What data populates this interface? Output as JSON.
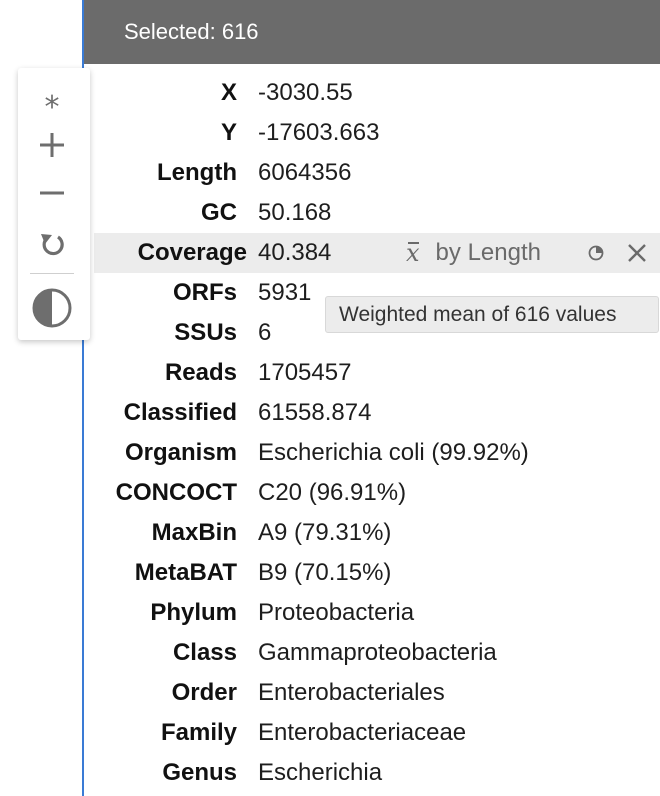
{
  "header": {
    "title": "Selected: 616"
  },
  "toolbar": {
    "asterisk": "*",
    "buttons": [
      "asterisk-icon",
      "plus-icon",
      "minus-icon",
      "reset-icon",
      "contrast-icon"
    ]
  },
  "coverage_tools": {
    "mean_symbol": "x",
    "weight_label": "by Length",
    "tooltip": "Weighted mean of 616 values"
  },
  "rows": [
    {
      "key": "X",
      "value": "-3030.55"
    },
    {
      "key": "Y",
      "value": "-17603.663"
    },
    {
      "key": "Length",
      "value": "6064356"
    },
    {
      "key": "GC",
      "value": "50.168"
    },
    {
      "key": "Coverage",
      "value": "40.384"
    },
    {
      "key": "ORFs",
      "value": "5931"
    },
    {
      "key": "SSUs",
      "value": "6"
    },
    {
      "key": "Reads",
      "value": "1705457"
    },
    {
      "key": "Classified",
      "value": "61558.874"
    },
    {
      "key": "Organism",
      "value": "Escherichia coli (99.92%)"
    },
    {
      "key": "CONCOCT",
      "value": "C20 (96.91%)"
    },
    {
      "key": "MaxBin",
      "value": "A9 (79.31%)"
    },
    {
      "key": "MetaBAT",
      "value": "B9 (70.15%)"
    },
    {
      "key": "Phylum",
      "value": "Proteobacteria"
    },
    {
      "key": "Class",
      "value": "Gammaproteobacteria"
    },
    {
      "key": "Order",
      "value": "Enterobacteriales"
    },
    {
      "key": "Family",
      "value": "Enterobacteriaceae"
    },
    {
      "key": "Genus",
      "value": "Escherichia"
    }
  ],
  "colors": {
    "header_bg": "#6b6b6b",
    "panel_border": "#3a7bd5",
    "highlight_bg": "#ececec",
    "icon_gray": "#6e6e6e"
  }
}
